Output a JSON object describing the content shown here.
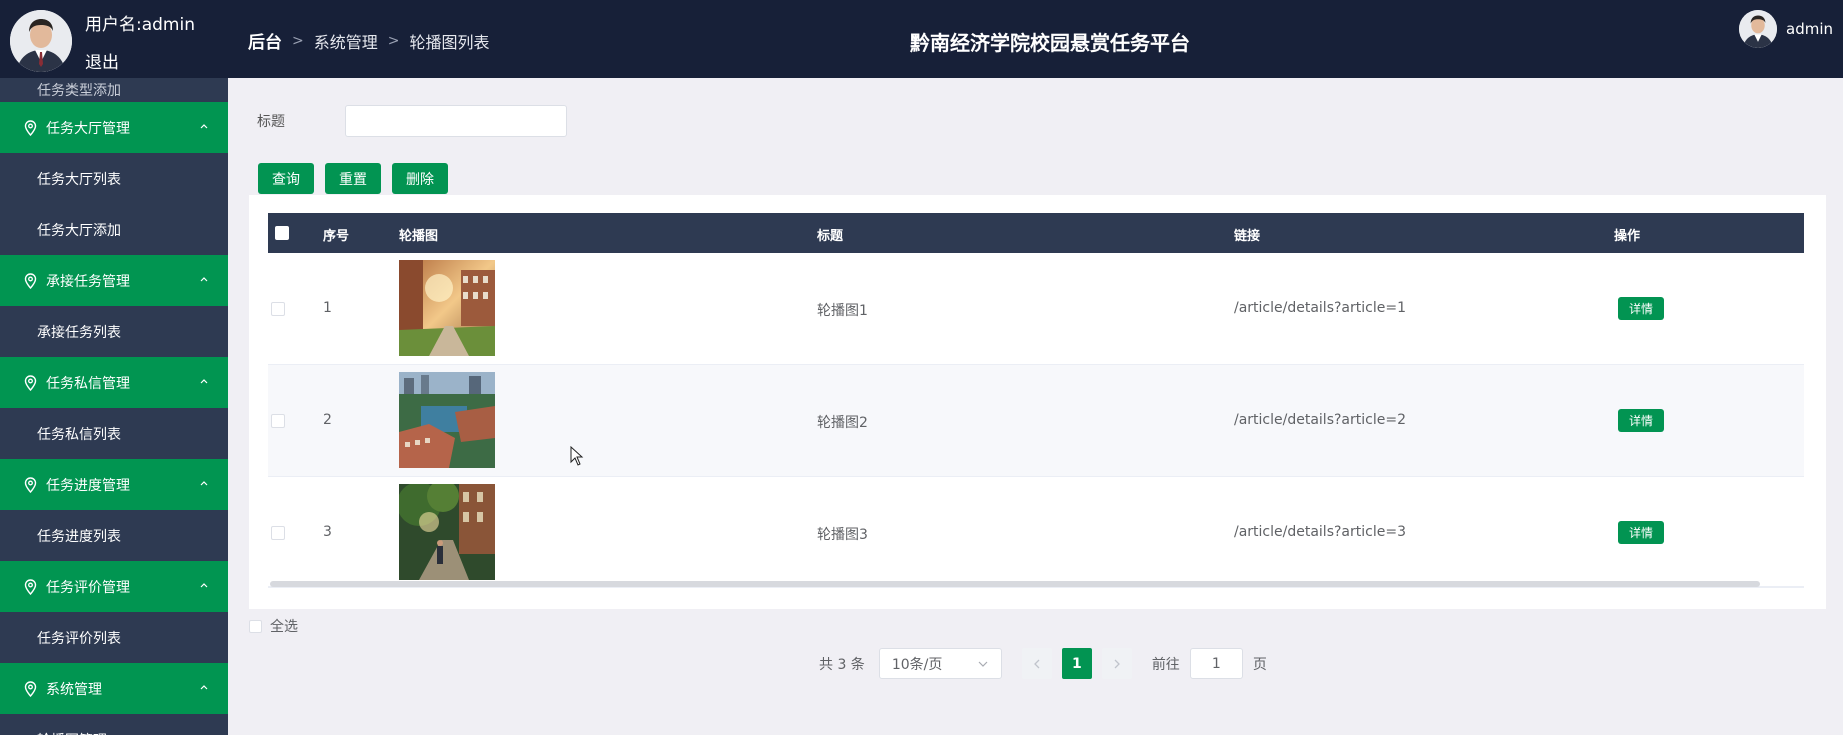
{
  "header": {
    "user_label": "用户名:admin",
    "logout": "退出",
    "breadcrumb": [
      "后台",
      "系统管理",
      "轮播图列表"
    ],
    "title": "黔南经济学院校园悬赏任务平台",
    "right_user": "admin"
  },
  "sidebar": {
    "partial_top": "任务类型添加",
    "groups": [
      {
        "label": "任务大厅管理",
        "items": [
          "任务大厅列表",
          "任务大厅添加"
        ]
      },
      {
        "label": "承接任务管理",
        "items": [
          "承接任务列表"
        ]
      },
      {
        "label": "任务私信管理",
        "items": [
          "任务私信列表"
        ]
      },
      {
        "label": "任务进度管理",
        "items": [
          "任务进度列表"
        ]
      },
      {
        "label": "任务评价管理",
        "items": [
          "任务评价列表"
        ]
      },
      {
        "label": "系统管理",
        "items": [
          "轮播图管理"
        ]
      }
    ]
  },
  "search": {
    "label": "标题",
    "value": ""
  },
  "buttons": {
    "query": "查询",
    "reset": "重置",
    "delete": "删除"
  },
  "table": {
    "columns": [
      "序号",
      "轮播图",
      "标题",
      "链接",
      "操作"
    ],
    "rows": [
      {
        "index": "1",
        "title": "轮播图1",
        "link": "/article/details?article=1",
        "action": "详情"
      },
      {
        "index": "2",
        "title": "轮播图2",
        "link": "/article/details?article=2",
        "action": "详情"
      },
      {
        "index": "3",
        "title": "轮播图3",
        "link": "/article/details?article=3",
        "action": "详情"
      }
    ]
  },
  "select_all": "全选",
  "pagination": {
    "total": "共 3 条",
    "page_size": "10条/页",
    "current": "1",
    "goto_label": "前往",
    "goto_value": "1",
    "page_unit": "页"
  },
  "colors": {
    "header_bg": "#172038",
    "sidebar_bg": "#2e3a52",
    "accent": "#029452",
    "table_head": "#2e3a52"
  }
}
